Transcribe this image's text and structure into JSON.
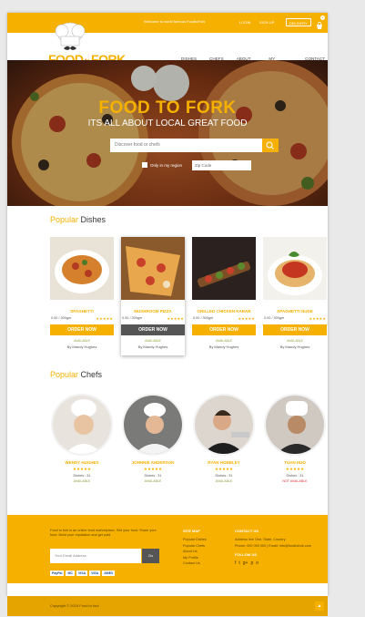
{
  "topbar": {
    "welcome": "Welcome to world famous FoodtoFork",
    "login": "LOGIN",
    "signup": "SIGN UP",
    "delivery": "DELIVERY",
    "cart_count": "0"
  },
  "brand": {
    "part1": "FOOD",
    "part2": "to",
    "part3": "FORK"
  },
  "nav": [
    "DISHES",
    "CHEFS",
    "ABOUT US",
    "MY PROFILE",
    "CONTACT"
  ],
  "hero": {
    "title": "FOOD TO FORK",
    "subtitle": "ITS ALL ABOUT LOCAL GREAT FOOD",
    "search_placeholder": "Discover food or chefs",
    "checkbox_label": "Only in my region",
    "zip_placeholder": "Zip Code"
  },
  "dishes": {
    "title_hl": "Popular",
    "title_rest": " Dishes",
    "items": [
      {
        "name": "SPAGHETTI",
        "price": "0.00 / 300gm",
        "stars": "★★★★★",
        "order": "ORDER NOW",
        "status": "AVAILABLE",
        "by": "By Mandy Hughes"
      },
      {
        "name": "MUSHROOM PIZZA",
        "price": "0.00 / 300gm",
        "stars": "★★★★★",
        "order": "ORDER NOW",
        "status": "AVAILABLE",
        "by": "By Mandy Hughes"
      },
      {
        "name": "GRILLED CHICKEN KABAB",
        "price": "0.00 / 300gm",
        "stars": "★★★★★",
        "order": "ORDER NOW",
        "status": "AVAILABLE",
        "by": "By Mandy Hughes"
      },
      {
        "name": "SPAGHETTI NUDE",
        "price": "0.00 / 300gm",
        "stars": "★★★★★",
        "order": "ORDER NOW",
        "status": "AVAILABLE",
        "by": "By Mandy Hughes"
      }
    ]
  },
  "chefs": {
    "title_hl": "Popular",
    "title_rest": " Chefs",
    "items": [
      {
        "name": "WENDY HUGHES",
        "stars": "★★★★★",
        "count": "Dishes : 31",
        "status": "AVAILABLE"
      },
      {
        "name": "JOHNNIE ANDERSON",
        "stars": "★★★★★",
        "count": "Dishes : 31",
        "status": "AVAILABLE"
      },
      {
        "name": "RYAN HOBBLEY",
        "stars": "★★★★★",
        "count": "Dishes : 31",
        "status": "AVAILABLE"
      },
      {
        "name": "TUAN HUO",
        "stars": "★★★★★",
        "count": "Dishes : 31",
        "status": "NOT AVAILABLE"
      }
    ]
  },
  "footer": {
    "about": "Food to fork is an online food marketplace. Sell your food. Share your food. Build your reputation and get paid.",
    "email_placeholder": "Your Email Address",
    "go": "Go",
    "payments": [
      "PayPal",
      "MC",
      "VISA",
      "VISA",
      "AMEX"
    ],
    "col1_title": "SITE MAP",
    "col1_links": [
      "Popular Dishes",
      "Popular Chefs",
      "About Us",
      "My Profile",
      "Contact Us"
    ],
    "col2_title": "CONTACT US",
    "col2_lines": [
      "Address line One, State, Country",
      "Phone: 000 000 000 | Email: info@foodtofork.com"
    ],
    "follow_title": "FOLLOW US",
    "social": [
      "f",
      "t",
      "g+",
      "p",
      "o"
    ]
  },
  "copyright": "Copyright © 2015 Food to fork",
  "colors": {
    "accent": "#f6b100",
    "dark": "#555555"
  }
}
